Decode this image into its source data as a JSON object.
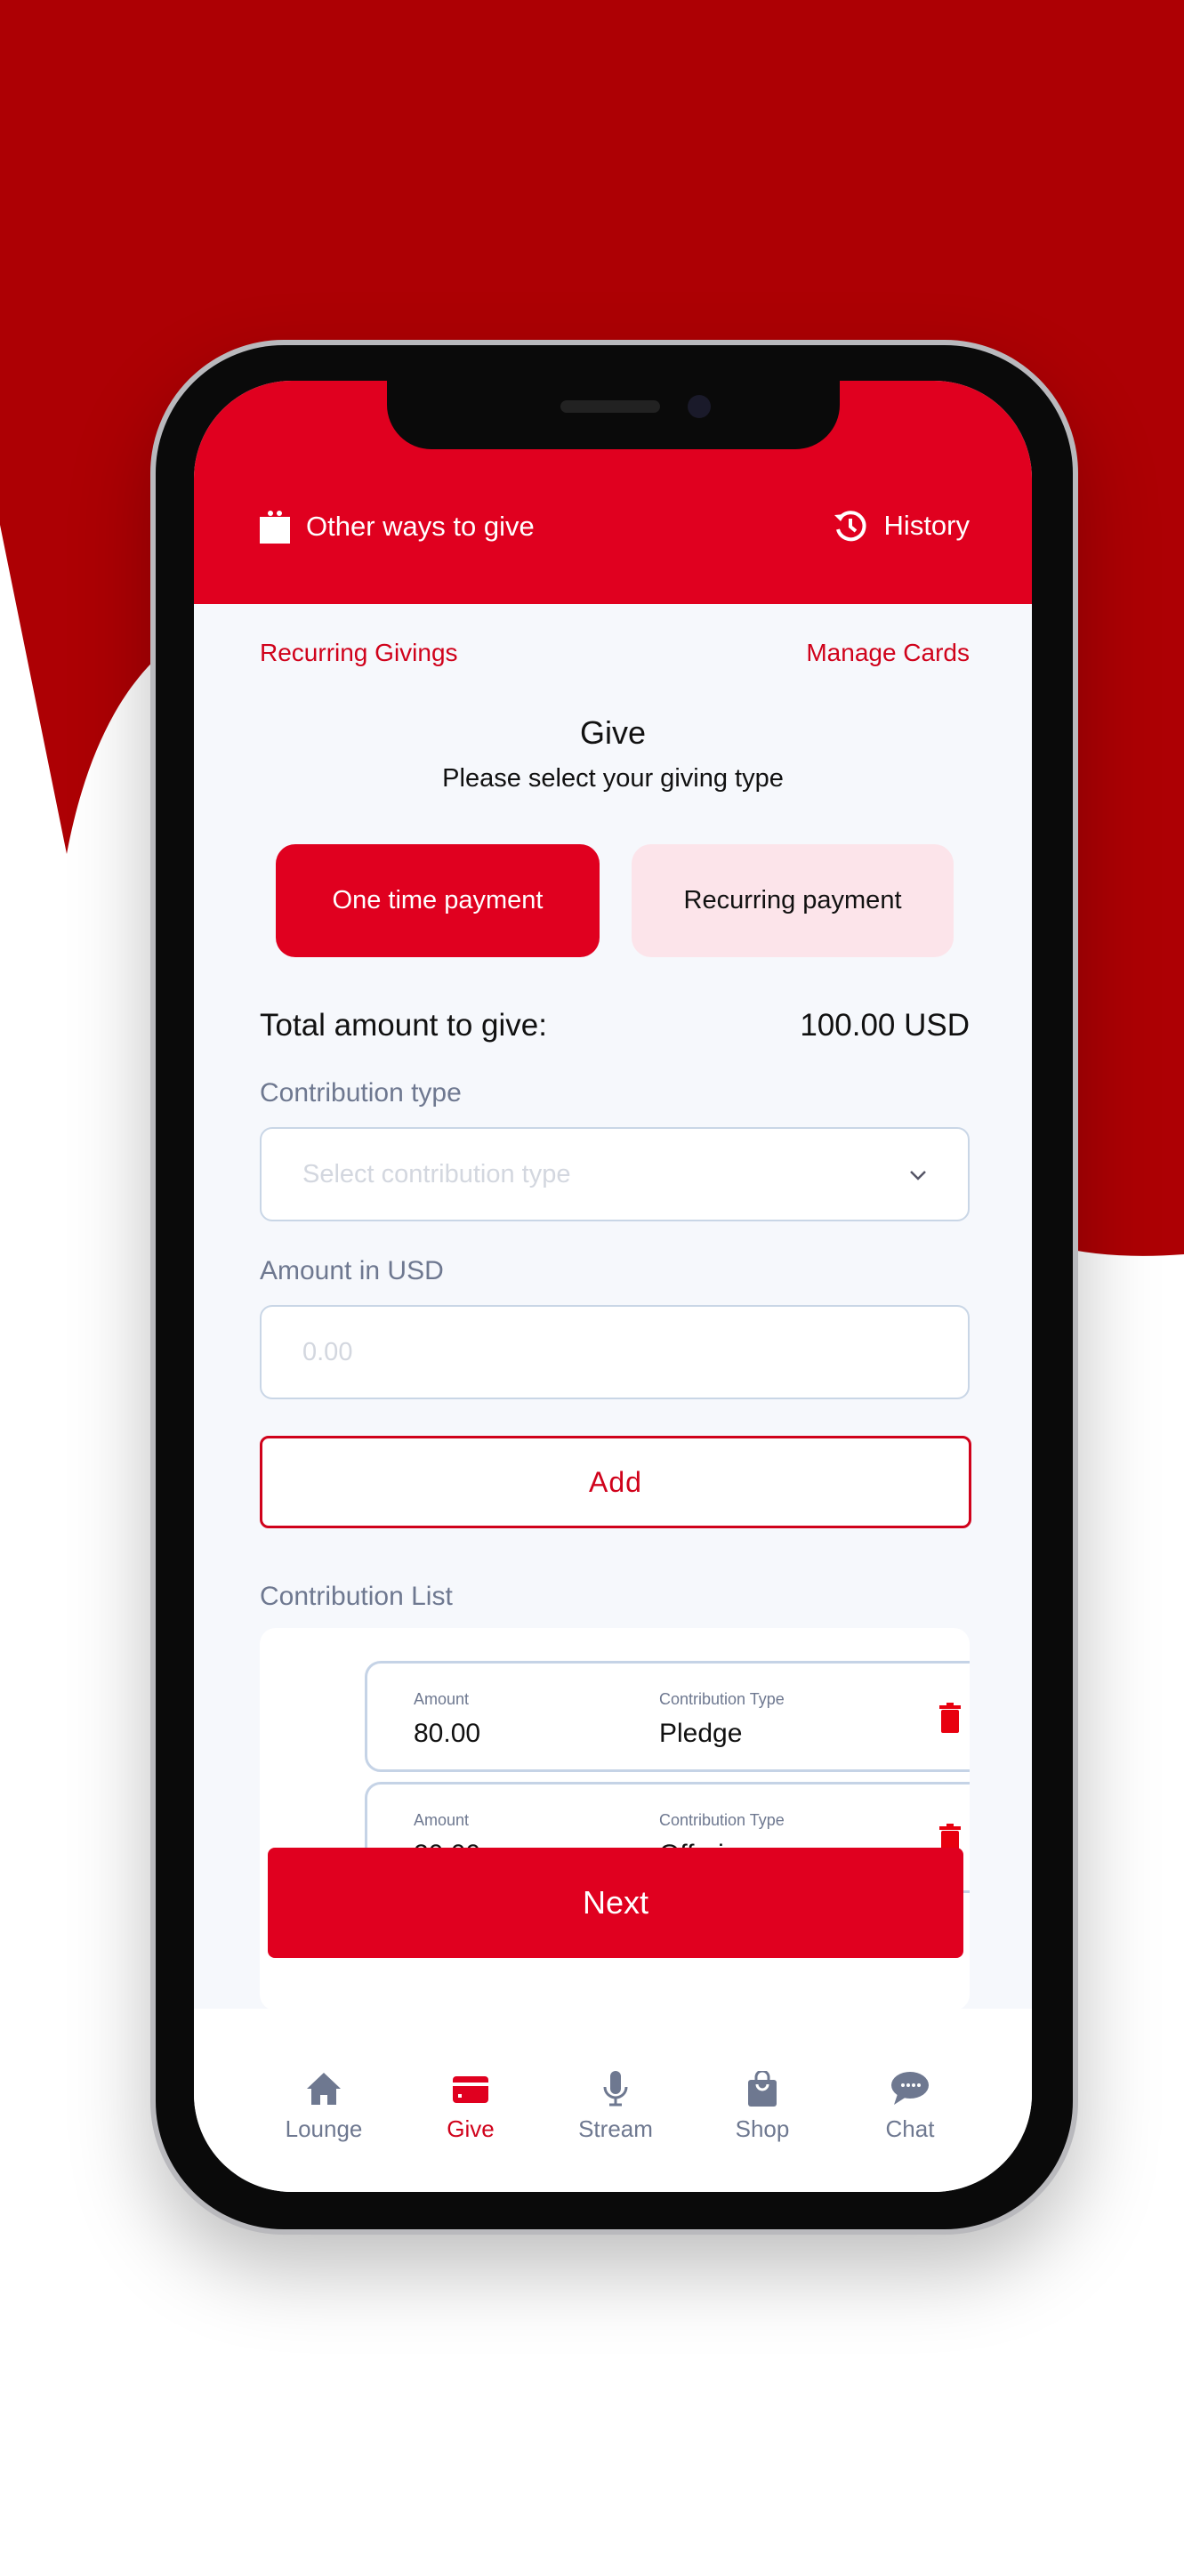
{
  "header": {
    "other_ways": "Other ways to give",
    "history": "History"
  },
  "links": {
    "recurring_givings": "Recurring Givings",
    "manage_cards": "Manage Cards"
  },
  "page": {
    "title": "Give",
    "subtitle": "Please select your giving type"
  },
  "payment_types": [
    {
      "label": "One time payment",
      "selected": true
    },
    {
      "label": "Recurring payment",
      "selected": false
    }
  ],
  "total": {
    "label": "Total amount to give:",
    "value": "100.00 USD"
  },
  "contribution_type": {
    "label": "Contribution type",
    "placeholder": "Select contribution type"
  },
  "amount": {
    "label": "Amount in USD",
    "placeholder": "0.00"
  },
  "add_label": "Add",
  "list": {
    "title": "Contribution List",
    "amount_header": "Amount",
    "type_header": "Contribution Type",
    "items": [
      {
        "amount": "80.00",
        "type": "Pledge"
      },
      {
        "amount": "20.00",
        "type": "Offering"
      }
    ]
  },
  "next_label": "Next",
  "nav": [
    {
      "label": "Lounge",
      "icon": "home-icon"
    },
    {
      "label": "Give",
      "icon": "card-icon",
      "active": true
    },
    {
      "label": "Stream",
      "icon": "microphone-icon"
    },
    {
      "label": "Shop",
      "icon": "bag-icon"
    },
    {
      "label": "Chat",
      "icon": "chat-icon"
    }
  ],
  "colors": {
    "brand": "#e0001f",
    "background_red": "#ad0004",
    "active_nav": "#d0021b",
    "inactive_nav": "#6e7890"
  }
}
